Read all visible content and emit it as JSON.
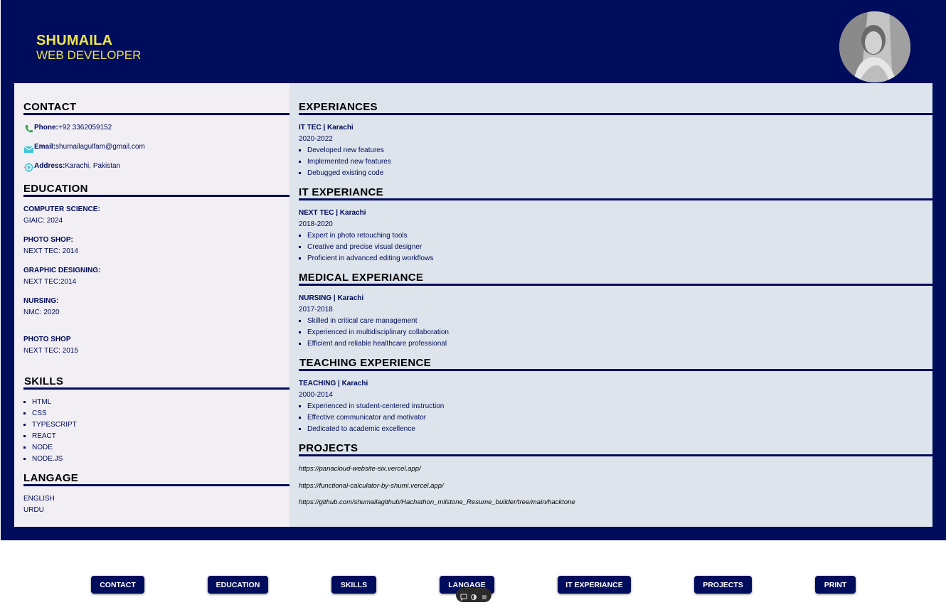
{
  "header": {
    "name": "SHUMAILA",
    "role": "WEB DEVELOPER"
  },
  "contact": {
    "title": "CONTACT",
    "phone_label": "Phone:",
    "phone": "+92 3362059152",
    "email_label": "Email:",
    "email": "shumailagulfam@gmail.com",
    "address_label": "Address:",
    "address": "Karachi, Pakistan"
  },
  "education": {
    "title": "EDUCATION",
    "items": [
      {
        "degree": "COMPUTER SCIENCE:",
        "detail": "GIAIC: 2024"
      },
      {
        "degree": "PHOTO SHOP:",
        "detail": "NEXT TEC: 2014"
      },
      {
        "degree": "GRAPHIC DESIGNING:",
        "detail": "NEXT TEC:2014"
      },
      {
        "degree": "NURSING:",
        "detail": "NMC: 2020"
      },
      {
        "degree": "PHOTO SHOP",
        "detail": "NEXT TEC: 2015"
      }
    ]
  },
  "skills": {
    "title": "SKILLS",
    "items": [
      "HTML",
      "CSS",
      "TYPESCRIPT",
      "REACT",
      "NODE",
      "NODE.JS"
    ]
  },
  "languages": {
    "title": "LANGAGE",
    "items": [
      "ENGLISH",
      "URDU"
    ]
  },
  "experience": [
    {
      "title": "EXPERIANCES",
      "company": "IT TEC | Karachi",
      "years": "2020-2022",
      "points": [
        "Developed new features",
        "Implemented new features",
        "Debugged existing code"
      ]
    },
    {
      "title": "IT EXPERIANCE",
      "company": "NEXT TEC | Karachi",
      "years": "2018-2020",
      "points": [
        "Expert in photo retouching tools",
        "Creative and precise visual designer",
        "Proficient in advanced editing workflows"
      ]
    },
    {
      "title": "MEDICAL EXPERIANCE",
      "company": "NURSING | Karachi",
      "years": "2017-2018",
      "points": [
        "Skilled in critical care management",
        "Experienced in multidisciplinary collaboration",
        "Efficient and reliable healthcare professional"
      ]
    },
    {
      "title": "TEACHING EXPERIENCE",
      "company": "TEACHING | Karachi",
      "years": "2000-2014",
      "points": [
        "Experienced in student-centered instruction",
        "Effective communicator and motivator",
        "Dedicated to academic excellence"
      ]
    }
  ],
  "projects": {
    "title": "PROJECTS",
    "links": [
      "https://panacloud-website-six.vercel.app/",
      "https://functional-calculator-by-shumi.vercel.app/",
      "https://github.com/shumailagithub/Hachathon_milstone_Resume_builder/tree/main/hacktone"
    ]
  },
  "nav": {
    "buttons": [
      "CONTACT",
      "EDUCATION",
      "SKILLS",
      "LANGAGE",
      "IT EXPERIANCE",
      "PROJECTS",
      "PRINT"
    ]
  },
  "colors": {
    "navy": "#000c5c",
    "name_yellow": "#ede44a",
    "left_panel": "#f1eef4",
    "right_panel": "#dde4ec"
  },
  "icons": {
    "phone": "phone-icon",
    "email": "email-icon",
    "address": "location-icon"
  }
}
